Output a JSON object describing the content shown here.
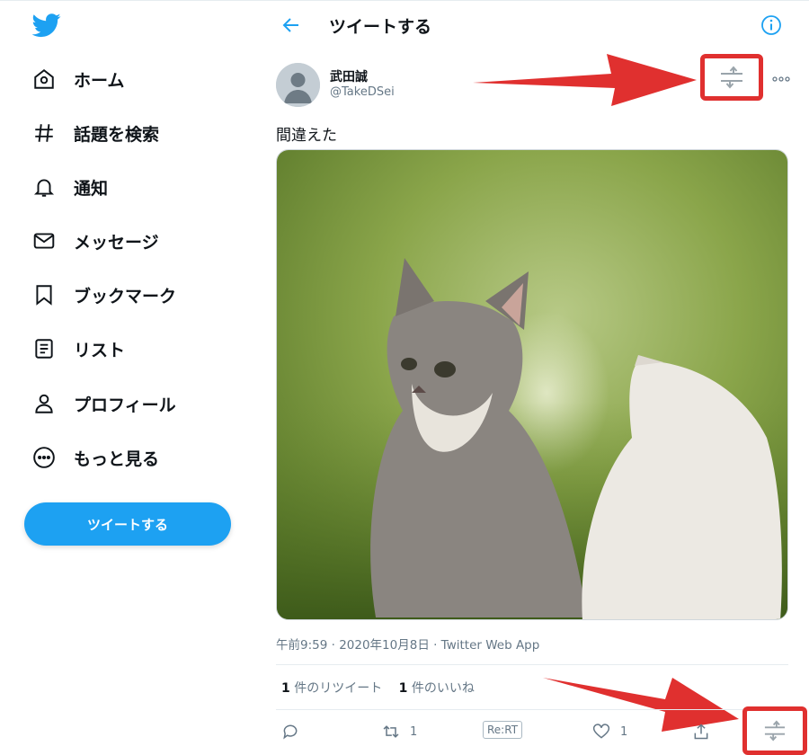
{
  "sidebar": {
    "items": [
      {
        "label": "ホーム",
        "icon": "home-icon"
      },
      {
        "label": "話題を検索",
        "icon": "hashtag-icon"
      },
      {
        "label": "通知",
        "icon": "bell-icon"
      },
      {
        "label": "メッセージ",
        "icon": "mail-icon"
      },
      {
        "label": "ブックマーク",
        "icon": "bookmark-icon"
      },
      {
        "label": "リスト",
        "icon": "list-icon"
      },
      {
        "label": "プロフィール",
        "icon": "person-icon"
      },
      {
        "label": "もっと見る",
        "icon": "more-circle-icon"
      }
    ],
    "tweet_button": "ツイートする"
  },
  "header": {
    "title": "ツイートする"
  },
  "tweet": {
    "user_name": "武田誠",
    "handle": "@TakeDSei",
    "text": "間違えた",
    "meta": "午前9:59 · 2020年10月8日 · Twitter Web App",
    "retweet_count": "1",
    "retweet_label": " 件のリツイート",
    "like_count": "1",
    "like_label": " 件のいいね",
    "action_retweet_count": "1",
    "action_like_count": "1",
    "rert_label": "Re:RT"
  },
  "colors": {
    "accent": "#1da1f2",
    "highlight": "#e0302f"
  }
}
